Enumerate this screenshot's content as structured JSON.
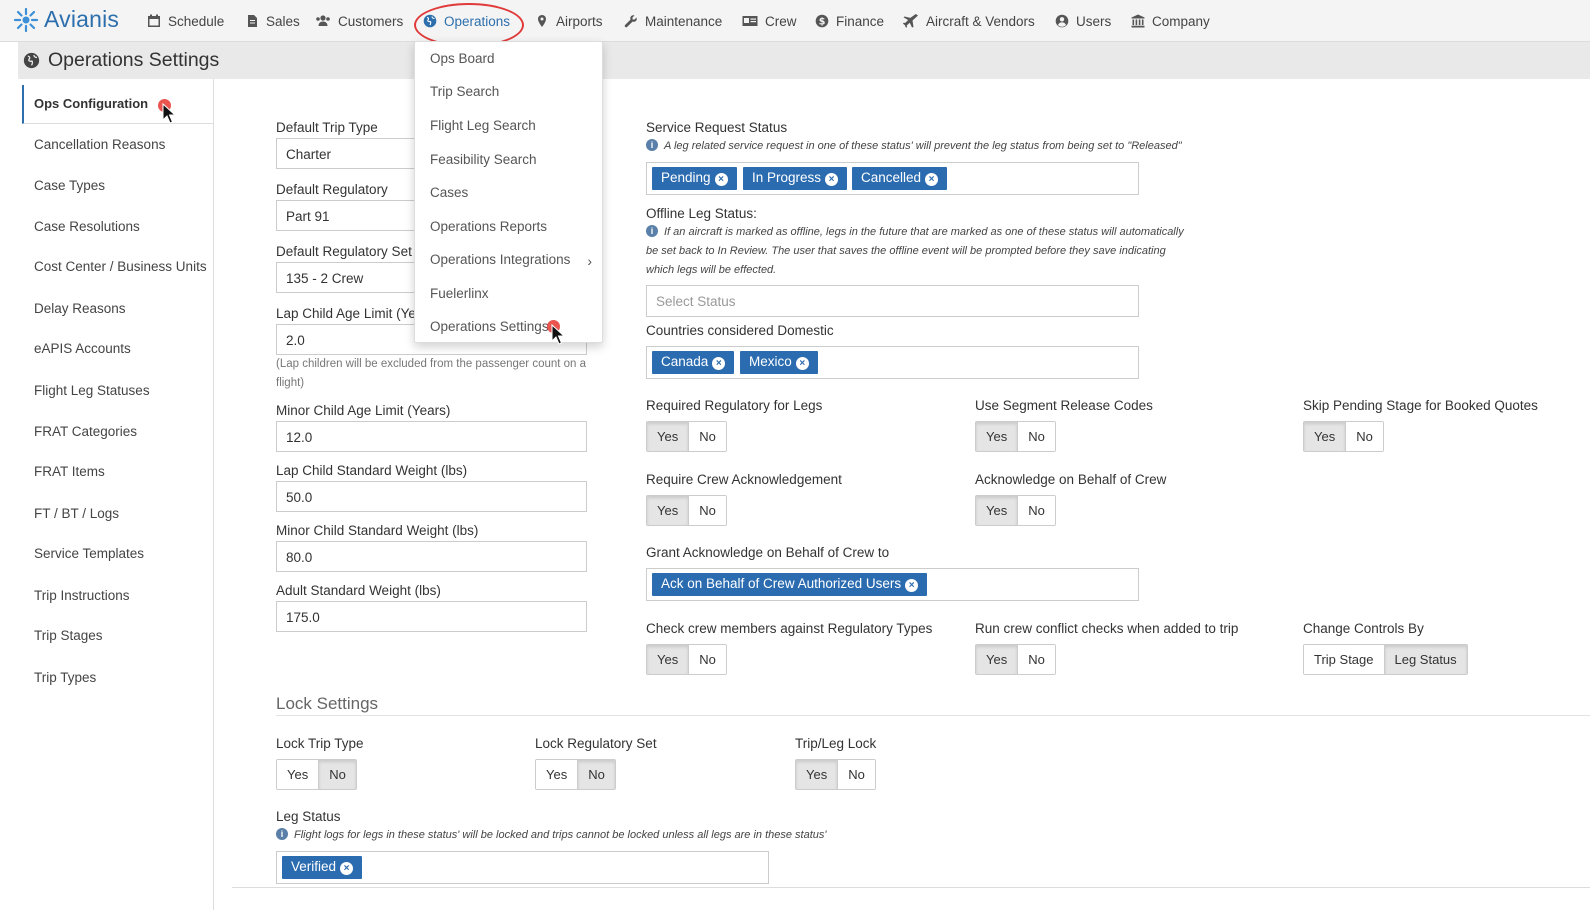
{
  "brand": {
    "name": "Avianis"
  },
  "nav": [
    {
      "label": "Schedule",
      "icon": "calendar-icon"
    },
    {
      "label": "Sales",
      "icon": "file-icon"
    },
    {
      "label": "Customers",
      "icon": "users-icon"
    },
    {
      "label": "Operations",
      "icon": "globe-icon",
      "active": true
    },
    {
      "label": "Airports",
      "icon": "map-marker-icon"
    },
    {
      "label": "Maintenance",
      "icon": "wrench-icon"
    },
    {
      "label": "Crew",
      "icon": "id-card-icon"
    },
    {
      "label": "Finance",
      "icon": "dollar-icon"
    },
    {
      "label": "Aircraft & Vendors",
      "icon": "plane-icon"
    },
    {
      "label": "Users",
      "icon": "user-circle-icon"
    },
    {
      "label": "Company",
      "icon": "bank-icon"
    }
  ],
  "page": {
    "title": "Operations Settings"
  },
  "sidebar": {
    "active": "Ops Configuration",
    "items": [
      "Cancellation Reasons",
      "Case Types",
      "Case Resolutions",
      "Cost Center / Business Units",
      "Delay Reasons",
      "eAPIS Accounts",
      "Flight Leg Statuses",
      "FRAT Categories",
      "FRAT Items",
      "FT / BT / Logs",
      "Service Templates",
      "Trip Instructions",
      "Trip Stages",
      "Trip Types"
    ]
  },
  "dropdown": {
    "items": [
      "Ops Board",
      "Trip Search",
      "Flight Leg Search",
      "Feasibility Search",
      "Cases",
      "Operations Reports",
      "Operations Integrations",
      "Fuelerlinx",
      "Operations Settings"
    ]
  },
  "form": {
    "default_trip_type": {
      "label": "Default Trip Type",
      "value": "Charter"
    },
    "default_regulatory": {
      "label": "Default Regulatory",
      "value": "Part 91"
    },
    "default_regulatory_set": {
      "label": "Default Regulatory Set",
      "value": "135 - 2 Crew"
    },
    "lap_child_age": {
      "label": "Lap Child Age Limit (Yea",
      "value": "2.0",
      "note": "(Lap children will be excluded from the passenger count on a flight)"
    },
    "minor_child_age": {
      "label": "Minor Child Age Limit (Years)",
      "value": "12.0"
    },
    "lap_child_weight": {
      "label": "Lap Child Standard Weight (lbs)",
      "value": "50.0"
    },
    "minor_child_weight": {
      "label": "Minor Child Standard Weight (lbs)",
      "value": "80.0"
    },
    "adult_weight": {
      "label": "Adult Standard Weight (lbs)",
      "value": "175.0"
    }
  },
  "right": {
    "service_request": {
      "label": "Service Request Status",
      "note": "A leg related service request in one of these status' will prevent the leg status from being set to \"Released\"",
      "tags": [
        "Pending",
        "In Progress",
        "Cancelled"
      ]
    },
    "offline_leg": {
      "label": "Offline Leg Status:",
      "note": "If an aircraft is marked as offline, legs in the future that are marked as one of these status will automatically be set back to In Review. The user that saves the offline event will be prompted before they save indicating which legs will be effected.",
      "placeholder": "Select Status"
    },
    "countries": {
      "label": "Countries considered Domestic",
      "tags": [
        "Canada",
        "Mexico"
      ]
    },
    "grant_ack": {
      "label": "Grant Acknowledge on Behalf of Crew to",
      "tags": [
        "Ack on Behalf of Crew Authorized Users"
      ]
    }
  },
  "toggles": {
    "yes": "Yes",
    "no": "No",
    "required_regulatory": {
      "label": "Required Regulatory for Legs",
      "value": "Yes"
    },
    "segment_release": {
      "label": "Use Segment Release Codes",
      "value": "Yes"
    },
    "skip_pending": {
      "label": "Skip Pending Stage for Booked Quotes",
      "value": "Yes"
    },
    "require_crew_ack": {
      "label": "Require Crew Acknowledgement",
      "value": "Yes"
    },
    "ack_behalf": {
      "label": "Acknowledge on Behalf of Crew",
      "value": "Yes"
    },
    "check_crew": {
      "label": "Check crew members against Regulatory Types",
      "value": "Yes"
    },
    "crew_conflict": {
      "label": "Run crew conflict checks when added to trip",
      "value": "Yes"
    },
    "change_controls": {
      "label": "Change Controls By",
      "options": [
        "Trip Stage",
        "Leg Status"
      ],
      "value": "Leg Status"
    }
  },
  "lock": {
    "title": "Lock Settings",
    "lock_trip_type": {
      "label": "Lock Trip Type",
      "value": "No"
    },
    "lock_regulatory_set": {
      "label": "Lock Regulatory Set",
      "value": "No"
    },
    "trip_leg_lock": {
      "label": "Trip/Leg Lock",
      "value": "Yes"
    },
    "leg_status": {
      "label": "Leg Status",
      "note": "Flight logs for legs in these status' will be locked and trips cannot be locked unless all legs are in these status'",
      "tags": [
        "Verified"
      ]
    }
  },
  "colors": {
    "accent": "#2d6fad",
    "tag": "#2b6cb0",
    "highlight": "#e03a3a"
  }
}
